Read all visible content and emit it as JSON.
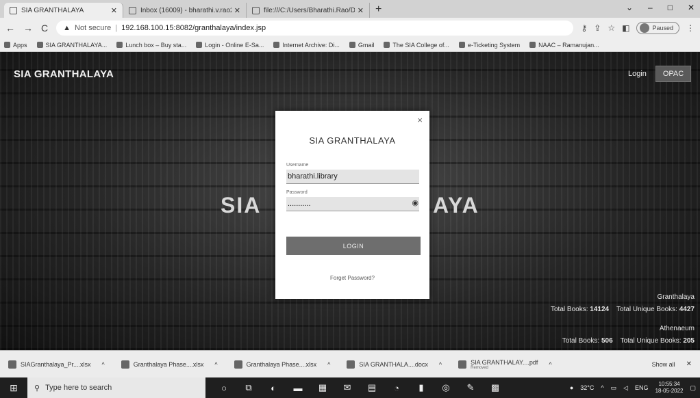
{
  "browser": {
    "tabs": [
      {
        "label": "SIA GRANTHALAYA",
        "active": true
      },
      {
        "label": "Inbox (16009) - bharathi.v.rao2",
        "active": false
      },
      {
        "label": "file:///C:/Users/Bharathi.Rao/Do...",
        "active": false
      }
    ],
    "new_tab": "+",
    "window_controls": [
      "⌄",
      "–",
      "□",
      "✕"
    ],
    "nav": {
      "back": "←",
      "forward": "→",
      "reload": "C"
    },
    "security_label": "Not secure",
    "url": "192.168.100.15:8082/granthalaya/index.jsp",
    "profile_status": "Paused",
    "bookmarks": [
      "Apps",
      "SIA GRANTHALAYA...",
      "Lunch box – Buy sta...",
      "Login - Online E-Sa...",
      "Internet Archive: Di...",
      "Gmail",
      "The SIA College of...",
      "e-Ticketing System",
      "NAAC – Ramanujan..."
    ]
  },
  "page": {
    "brand": "SIA GRANTHALAYA",
    "nav_login": "Login",
    "nav_opac": "OPAC",
    "hero_left": "SIA",
    "hero_right": "AYA",
    "stats": {
      "granthalaya_name": "Granthalaya",
      "granthalaya_total_label": "Total Books:",
      "granthalaya_total": "14124",
      "granthalaya_unique_label": "Total Unique Books:",
      "granthalaya_unique": "4427",
      "athenaeum_name": "Athenaeum",
      "athenaeum_total_label": "Total Books:",
      "athenaeum_total": "506",
      "athenaeum_unique_label": "Total Unique Books:",
      "athenaeum_unique": "205"
    }
  },
  "modal": {
    "title": "SIA GRANTHALAYA",
    "close": "×",
    "username_label": "Username",
    "username_value": "bharathi.library",
    "password_label": "Password",
    "password_value": "...........",
    "login_button": "LOGIN",
    "forgot_password": "Forget Password?"
  },
  "downloads": {
    "items": [
      {
        "name": "SIAGranthalaya_Pr....xlsx",
        "sub": ""
      },
      {
        "name": "Granthalaya Phase....xlsx",
        "sub": ""
      },
      {
        "name": "Granthalaya Phase....xlsx",
        "sub": ""
      },
      {
        "name": "SIA GRANTHALA....docx",
        "sub": ""
      },
      {
        "name": "SIA GRANTHALAY....pdf",
        "sub": "Removed"
      }
    ],
    "show_all": "Show all",
    "close": "✕"
  },
  "taskbar": {
    "search_placeholder": "Type here to search",
    "weather": "32°C",
    "language": "ENG",
    "time": "10:55:34",
    "date": "18-05-2022"
  }
}
